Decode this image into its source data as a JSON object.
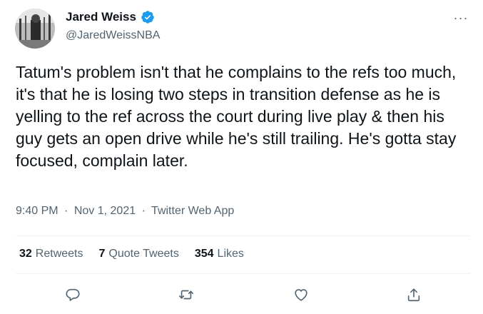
{
  "author": {
    "name": "Jared Weiss",
    "handle": "@JaredWeissNBA",
    "verified_color": "#1d9bf0"
  },
  "tweet": {
    "text": "Tatum's problem isn't that he complains to the refs too much, it's that he is losing two steps in transition defense as he is yelling to the ref across the court during live play & then his guy gets an open drive while he's still trailing. He's gotta stay focused, complain later.",
    "time": "9:40 PM",
    "date": "Nov 1, 2021",
    "source": "Twitter Web App",
    "separator": "·"
  },
  "stats": {
    "retweets": {
      "count": "32",
      "label": "Retweets"
    },
    "quotes": {
      "count": "7",
      "label": "Quote Tweets"
    },
    "likes": {
      "count": "354",
      "label": "Likes"
    }
  },
  "menu": {
    "more_label": "···"
  },
  "actions": [
    "reply-icon",
    "retweet-icon",
    "like-icon",
    "share-icon"
  ],
  "colors": {
    "text": "#0f1419",
    "secondary": "#536471",
    "divider": "#eff3f4"
  }
}
